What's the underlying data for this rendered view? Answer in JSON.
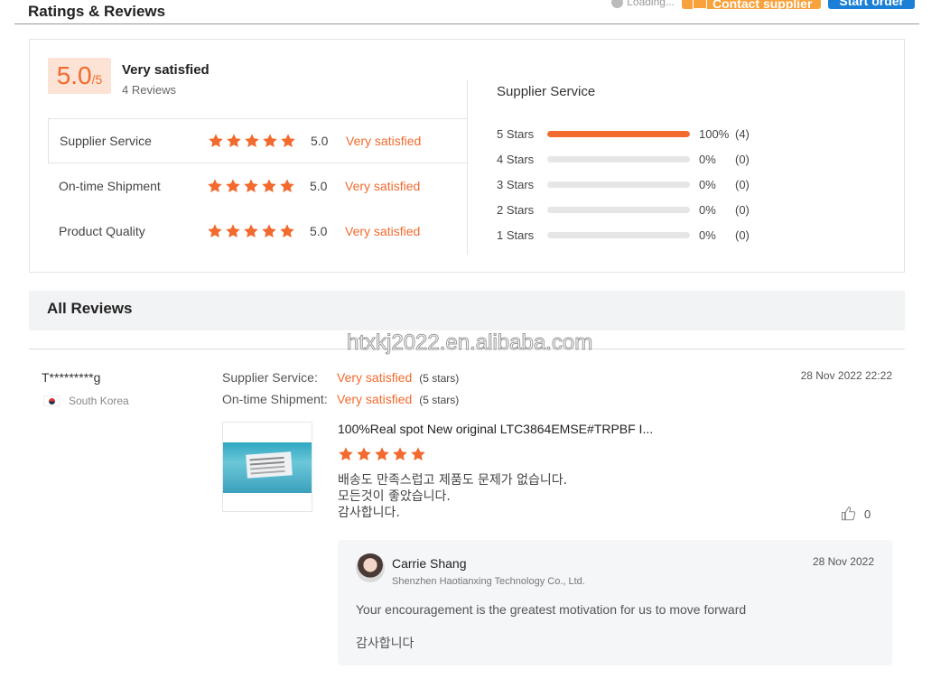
{
  "header": {
    "title": "Ratings & Reviews",
    "loading": "Loading...",
    "contact_label": "Contact supplier",
    "start_label": "Start order"
  },
  "summary": {
    "score": "5.0",
    "score_max": "/5",
    "overall_label": "Very satisfied",
    "review_count": "4 Reviews",
    "categories": [
      {
        "name": "Supplier Service",
        "score": "5.0",
        "label": "Very satisfied",
        "stars": 5
      },
      {
        "name": "On-time Shipment",
        "score": "5.0",
        "label": "Very satisfied",
        "stars": 5
      },
      {
        "name": "Product Quality",
        "score": "5.0",
        "label": "Very satisfied",
        "stars": 5
      }
    ],
    "distribution_title": "Supplier Service",
    "distribution": [
      {
        "label": "5  Stars",
        "percent_text": "100%",
        "count": "(4)",
        "fraction": 1.0
      },
      {
        "label": "4  Stars",
        "percent_text": "0%",
        "count": "(0)",
        "fraction": 0
      },
      {
        "label": "3  Stars",
        "percent_text": "0%",
        "count": "(0)",
        "fraction": 0
      },
      {
        "label": "2  Stars",
        "percent_text": "0%",
        "count": "(0)",
        "fraction": 0
      },
      {
        "label": "1  Stars",
        "percent_text": "0%",
        "count": "(0)",
        "fraction": 0
      }
    ]
  },
  "all_reviews": {
    "title": "All Reviews",
    "watermark": "htxkj2022.en.alibaba.com"
  },
  "review": {
    "reviewer": "T*********g",
    "country": "South Korea",
    "supplier_service_key": "Supplier Service:",
    "supplier_service_val": "Very satisfied",
    "supplier_service_sub": "(5 stars)",
    "shipment_key": "On-time Shipment:",
    "shipment_val": "Very satisfied",
    "shipment_sub": "(5 stars)",
    "date": "28 Nov 2022 22:22",
    "product_title": "100%Real spot New original LTC3864EMSE#TRPBF I...",
    "rating": 5,
    "text_line1": "배송도 만족스럽고 제품도 문제가 없습니다.",
    "text_line2": "모든것이 좋았습니다.",
    "text_line3": "감사합니다.",
    "likes": "0"
  },
  "reply": {
    "name": "Carrie Shang",
    "company": "Shenzhen Haotianxing Technology Co., Ltd.",
    "date": "28 Nov 2022",
    "text1": "Your encouragement is the greatest motivation for us to move forward",
    "text2": "감사합니다"
  },
  "colors": {
    "accent": "#f26a2e",
    "contact_button": "#f7a23c",
    "start_button": "#1b7fd6"
  }
}
